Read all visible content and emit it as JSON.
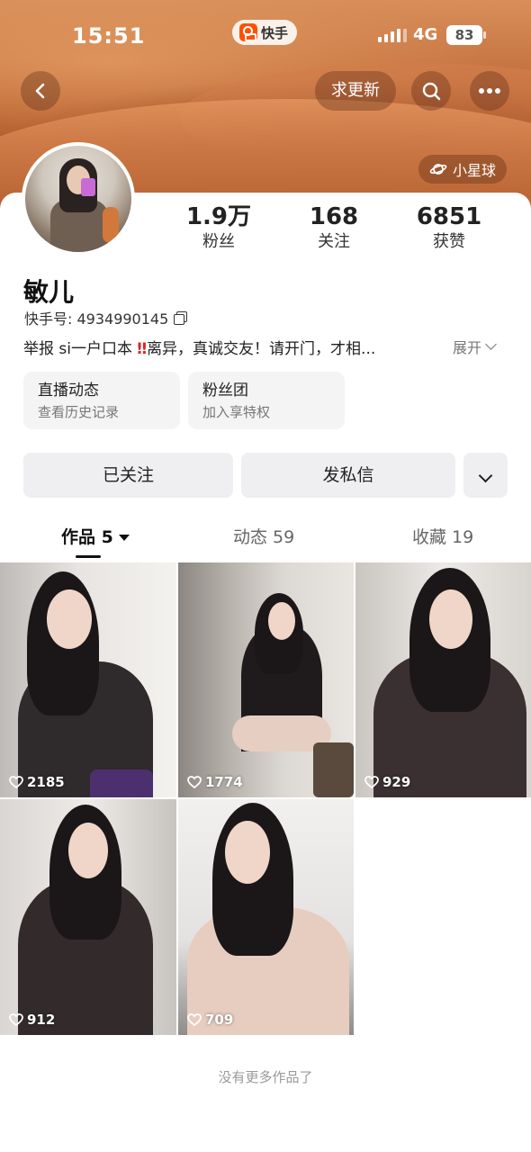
{
  "status_bar": {
    "time": "15:51",
    "app_pill": "快手",
    "network": "4G",
    "battery": "83"
  },
  "header": {
    "update_button": "求更新",
    "planet_button": "小星球"
  },
  "profile": {
    "name": "敏儿",
    "kuaishou_id": "快手号: 4934990145",
    "bio_start": "举报 si一户口本 ",
    "bio_mark": "‼",
    "bio_end": "离异，真诚交友！请开门，才相...",
    "expand_label": "展开",
    "stats": [
      {
        "num": "1.9万",
        "label": "粉丝"
      },
      {
        "num": "168",
        "label": "关注"
      },
      {
        "num": "6851",
        "label": "获赞"
      }
    ]
  },
  "cards": [
    {
      "title": "直播动态",
      "subtitle": "查看历史记录"
    },
    {
      "title": "粉丝团",
      "subtitle": "加入享特权"
    }
  ],
  "actions": {
    "follow": "已关注",
    "message": "发私信"
  },
  "tabs": [
    {
      "label": "作品 5",
      "active": true
    },
    {
      "label": "动态 59",
      "active": false
    },
    {
      "label": "收藏 19",
      "active": false
    }
  ],
  "videos": [
    {
      "likes": "2185"
    },
    {
      "likes": "1774"
    },
    {
      "likes": "929"
    },
    {
      "likes": "912"
    },
    {
      "likes": "709"
    }
  ],
  "footer_text": "没有更多作品了",
  "colors": {
    "banner_top": "#d98f5a",
    "banner_bottom": "#9f4c22",
    "button_gray": "#efeff1",
    "accent_red": "#e02020"
  }
}
